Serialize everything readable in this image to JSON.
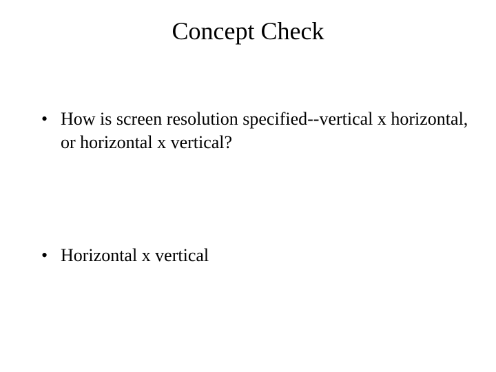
{
  "slide": {
    "title": "Concept Check",
    "bullets": [
      "How is screen resolution specified--vertical x horizontal, or horizontal x vertical?",
      "Horizontal x vertical"
    ]
  }
}
